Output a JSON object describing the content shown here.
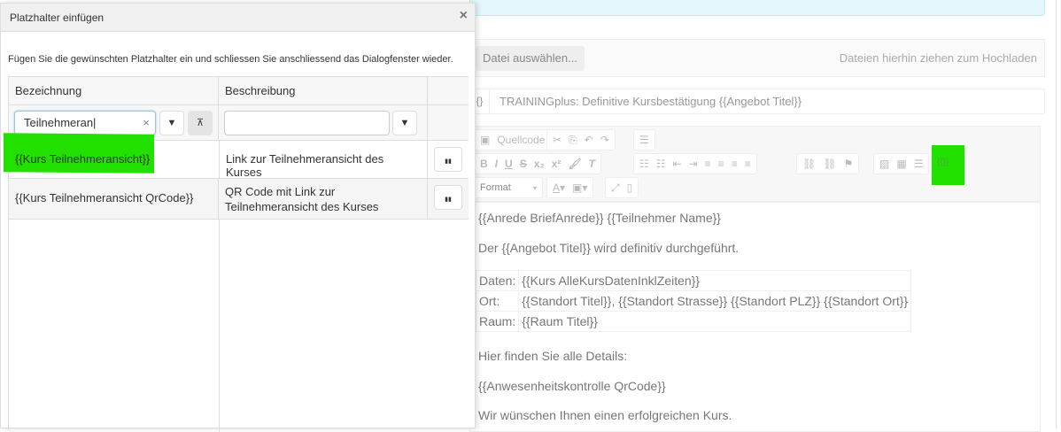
{
  "dialog": {
    "title": "Platzhalter einfügen",
    "close": "×",
    "intro": "Fügen Sie die gewünschten Platzhalter ein und schliessen Sie anschliessend das Dialogfenster wieder.",
    "columns": [
      "Bezeichnung",
      "Beschreibung"
    ],
    "filter_value": "Teilnehmeran",
    "clear": "×",
    "filter_icon": "▼",
    "clear_filter_icon": "⊼",
    "rows": [
      {
        "name": "{{Kurs Teilnehmeransicht}}",
        "desc": "Link zur Teilnehmeransicht des Kurses"
      },
      {
        "name": "{{Kurs Teilnehmeransicht QrCode}}",
        "desc": "QR Code mit Link zur Teilnehmeransicht des Kurses"
      }
    ],
    "copy_icon": "▮▮"
  },
  "upload": {
    "button": "Datei auswählen...",
    "hint": "Dateien hierhin ziehen zum Hochladen"
  },
  "subject": {
    "prefix": "{}",
    "value": "TRAININGplus: Definitive Kursbestätigung {{Angebot Titel}}"
  },
  "toolbar": {
    "source": "Quellcode",
    "format": "Format",
    "placeholder": "{{}}"
  },
  "editor": {
    "line1": "{{Anrede BriefAnrede}} {{Teilnehmer Name}}",
    "line2": "Der {{Angebot Titel}} wird definitiv durchgeführt.",
    "table": [
      [
        "Daten:",
        "{{Kurs AlleKursDatenInklZeiten}}"
      ],
      [
        "Ort:",
        "{{Standort Titel}}, {{Standort Strasse}} {{Standort PLZ}} {{Standort Ort}}"
      ],
      [
        "Raum:",
        "{{Raum Titel}}"
      ]
    ],
    "line3": "Hier finden Sie alle Details:",
    "line4": "{{Anwesenheitskontrolle QrCode}}",
    "line5": "Wir wünschen Ihnen einen erfolgreichen Kurs."
  }
}
